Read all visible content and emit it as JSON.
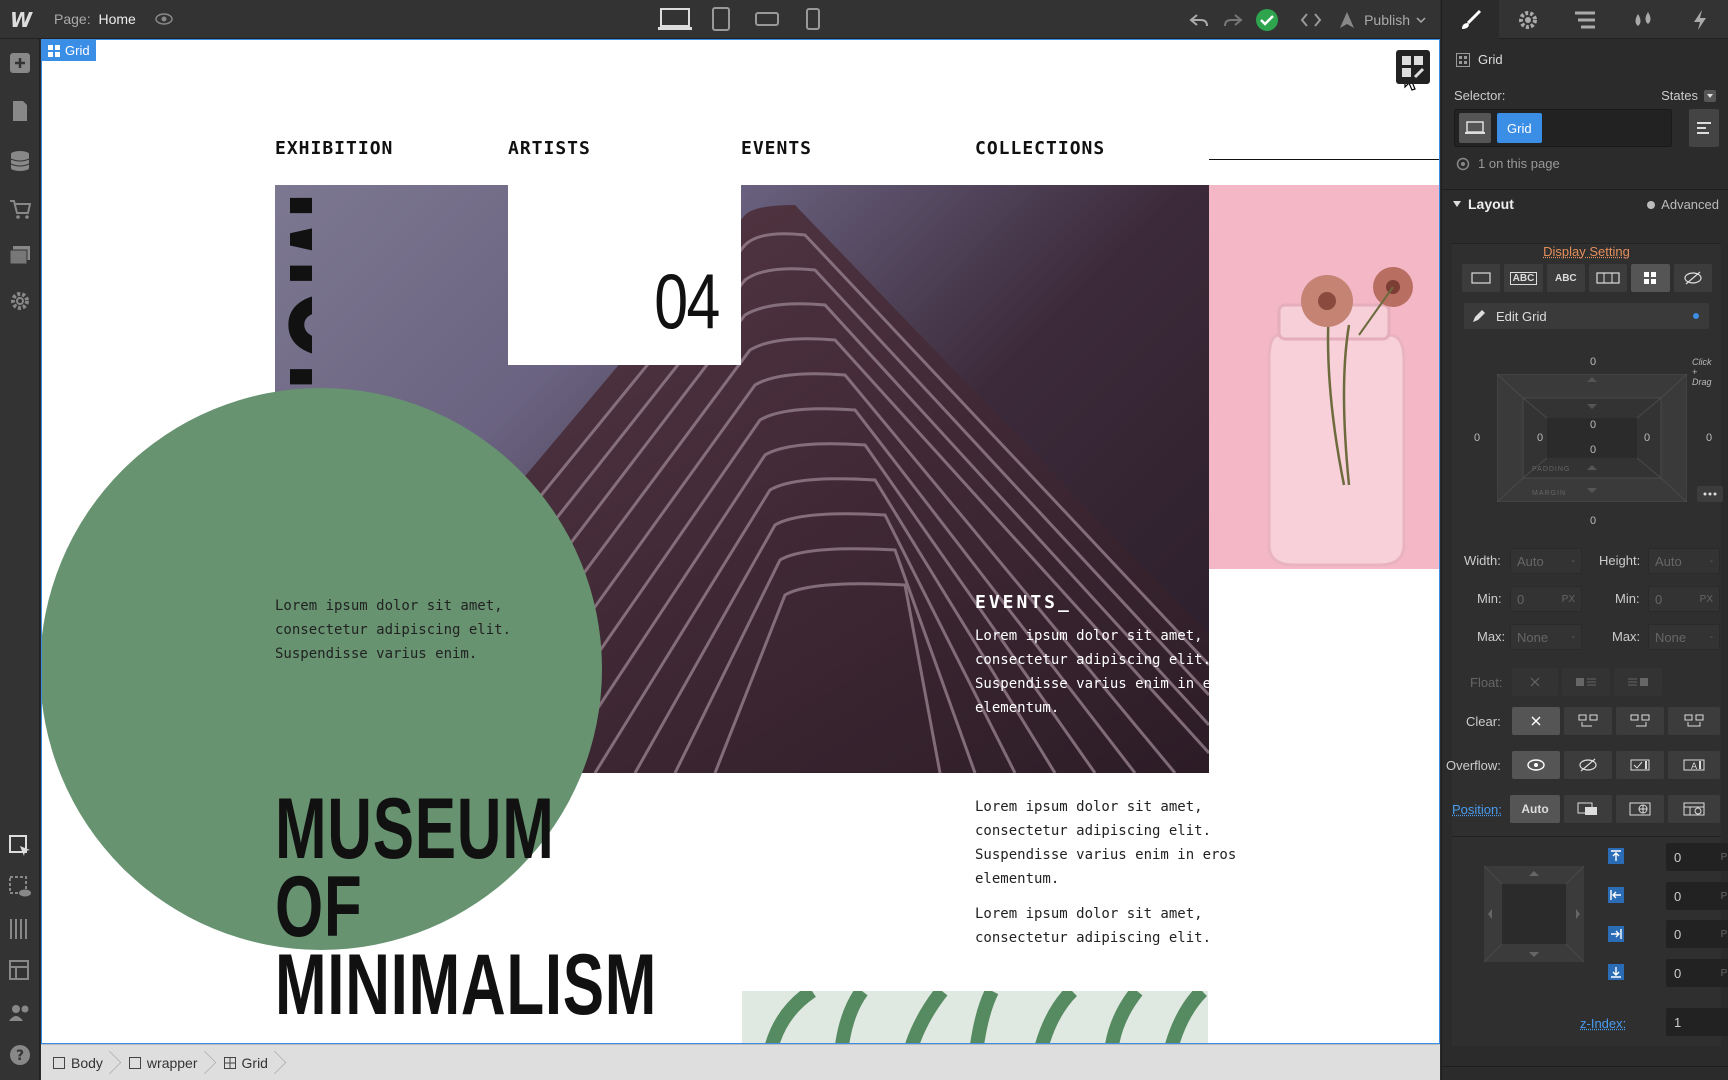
{
  "topbar": {
    "page_prefix": "Page:",
    "page_name": "Home",
    "publish_label": "Publish"
  },
  "canvas": {
    "grid_tag": "Grid",
    "nav": [
      "EXHIBITION",
      "ARTISTS",
      "EVENTS",
      "COLLECTIONS"
    ],
    "number": "04",
    "vertical_logo": "MoM",
    "circle_text": "Lorem ipsum dolor sit amet, consectetur adipiscing elit. Suspendisse varius enim.",
    "events_title": "EVENTS_",
    "events_text": "Lorem ipsum dolor sit amet, consectetur adipiscing elit. Suspendisse varius enim in eros elementum.",
    "body_text_1": "Lorem ipsum dolor sit amet, consectetur adipiscing elit. Suspendisse varius enim in eros elementum.",
    "body_text_2": "Lorem ipsum dolor sit amet, consectetur adipiscing elit.",
    "title_lines": [
      "MUSEUM",
      "OF",
      "MINIMALISM"
    ],
    "colors": {
      "circle": "#679371",
      "pink": "#f3b7c5",
      "selection": "#3b8ee6"
    }
  },
  "breadcrumbs": [
    "Body",
    "wrapper",
    "Grid"
  ],
  "panel": {
    "element_name": "Grid",
    "selector_label": "Selector:",
    "states_label": "States",
    "selector_chip": "Grid",
    "on_page": "1 on this page",
    "layout_title": "Layout",
    "advanced_label": "Advanced",
    "display_setting": "Display Setting",
    "display_options": [
      "block-icon",
      "ABC",
      "ABC",
      "flex-icon",
      "grid-icon",
      "hidden-icon"
    ],
    "edit_grid": "Edit Grid",
    "click_drag_hint": "Click + Drag",
    "box_model": {
      "margin_top": "0",
      "margin_bottom": "0",
      "margin_left": "0",
      "margin_right": "0",
      "padding_top": "0",
      "padding_bottom": "0",
      "padding_left": "0",
      "padding_right": "0",
      "padding_label": "PADDING",
      "margin_label": "MARGIN"
    },
    "width_label": "Width:",
    "width_value": "Auto",
    "height_label": "Height:",
    "height_value": "Auto",
    "min_label": "Min:",
    "min_w": "0",
    "min_h": "0",
    "unit_px": "PX",
    "max_label": "Max:",
    "max_w": "None",
    "max_h": "None",
    "float_label": "Float:",
    "clear_label": "Clear:",
    "overflow_label": "Overflow:",
    "position_label": "Position:",
    "position_value": "Auto",
    "offsets": [
      "0",
      "0",
      "0",
      "0"
    ],
    "zindex_label": "z-Index:",
    "zindex_value": "1"
  }
}
